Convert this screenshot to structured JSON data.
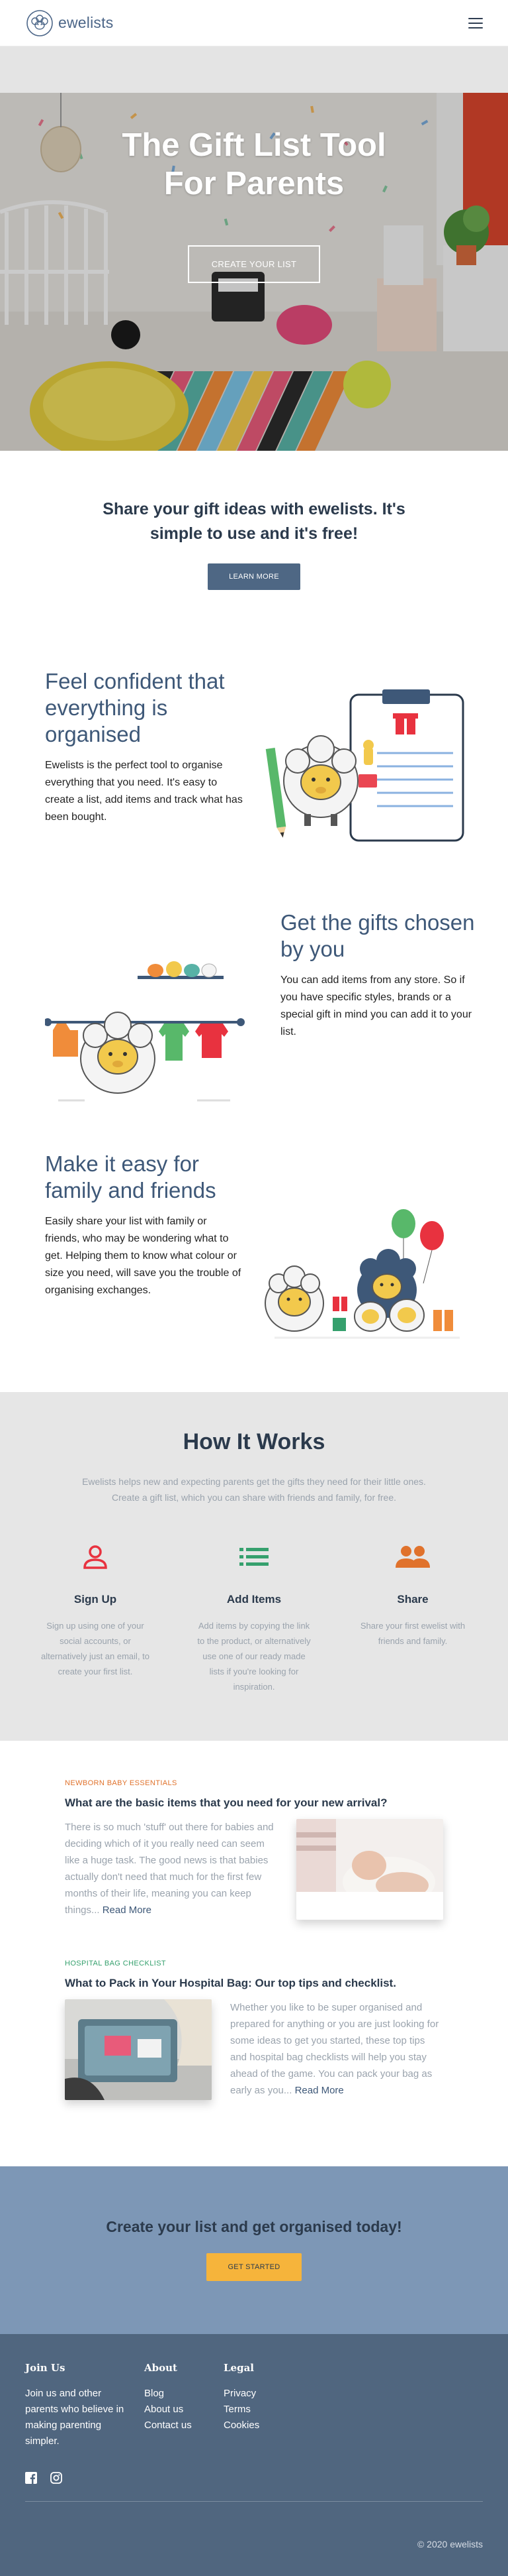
{
  "header": {
    "logo_text": "ewelists"
  },
  "hero": {
    "title": "The Gift List Tool\nFor Parents",
    "button_label": "CREATE YOUR LIST"
  },
  "share": {
    "title": "Share your gift ideas with ewelists. It's\nsimple to use and it's free!",
    "button_label": "LEARN MORE"
  },
  "features": [
    {
      "title": "Feel confident that everything is organised",
      "text": "Ewelists is the perfect tool to organise everything that you need. It's easy to create a list, add items and track what has been bought."
    },
    {
      "title": "Get the gifts chosen by you",
      "text": "You can add items from any store. So if you have specific styles, brands or a special gift in mind you can add it to your list."
    },
    {
      "title": "Make it easy for family and friends",
      "text": "Easily share your list with family or friends, who may be wondering what to get. Helping them to know what colour or size you need, will save you the trouble of organising exchanges."
    }
  ],
  "how": {
    "title": "How It Works",
    "description_1": "Ewelists helps new and expecting parents get the gifts they need for their little ones.",
    "description_2": "Create a gift list, which you can share with friends and family, for free.",
    "steps": [
      {
        "icon": "person-icon",
        "color": "#e8323f",
        "title": "Sign Up",
        "text": "Sign up using one of your social accounts, or alternatively just an email, to create your first list."
      },
      {
        "icon": "list-icon",
        "color": "#35a06d",
        "title": "Add Items",
        "text": "Add items by copying the link to the product, or alternatively use one of our ready made lists if you're looking for inspiration."
      },
      {
        "icon": "people-icon",
        "color": "#e0722c",
        "title": "Share",
        "text": "Share your first ewelist with friends and family."
      }
    ]
  },
  "articles": [
    {
      "category": "NEWBORN BABY ESSENTIALS",
      "title": "What are the basic items that you need for your new arrival?",
      "text": "There is so much 'stuff' out there for babies and deciding which of it you really need can seem like a huge task. The good news is that babies actually don't need that much for the first few months of their life, meaning you can keep things...",
      "read_more": "Read More"
    },
    {
      "category": "HOSPITAL BAG CHECKLIST",
      "title": "What to Pack in Your Hospital Bag: Our top tips and checklist.",
      "text": "Whether you like to be super organised and prepared for anything or you are just looking for some ideas to get you started, these top tips and hospital bag checklists will help you stay ahead of the game. You can pack your bag as early as you...",
      "read_more": "Read More"
    }
  ],
  "cta": {
    "title": "Create your list and get organised today!",
    "button_label": "GET STARTED"
  },
  "footer": {
    "join_title": "Join Us",
    "join_text": "Join us and other parents who believe in making parenting simpler.",
    "about_title": "About",
    "about_links": [
      "Blog",
      "About us",
      "Contact us"
    ],
    "legal_title": "Legal",
    "legal_links": [
      "Privacy",
      "Terms",
      "Cookies"
    ],
    "copyright": "© 2020 ewelists"
  },
  "colors": {
    "brand": "#4c6688",
    "accent_orange": "#e0722c",
    "accent_green": "#35a06d",
    "accent_red": "#e8323f",
    "cta_bg": "#7d97b6",
    "button_yellow": "#f6b43b",
    "footer_bg": "#50667f"
  }
}
